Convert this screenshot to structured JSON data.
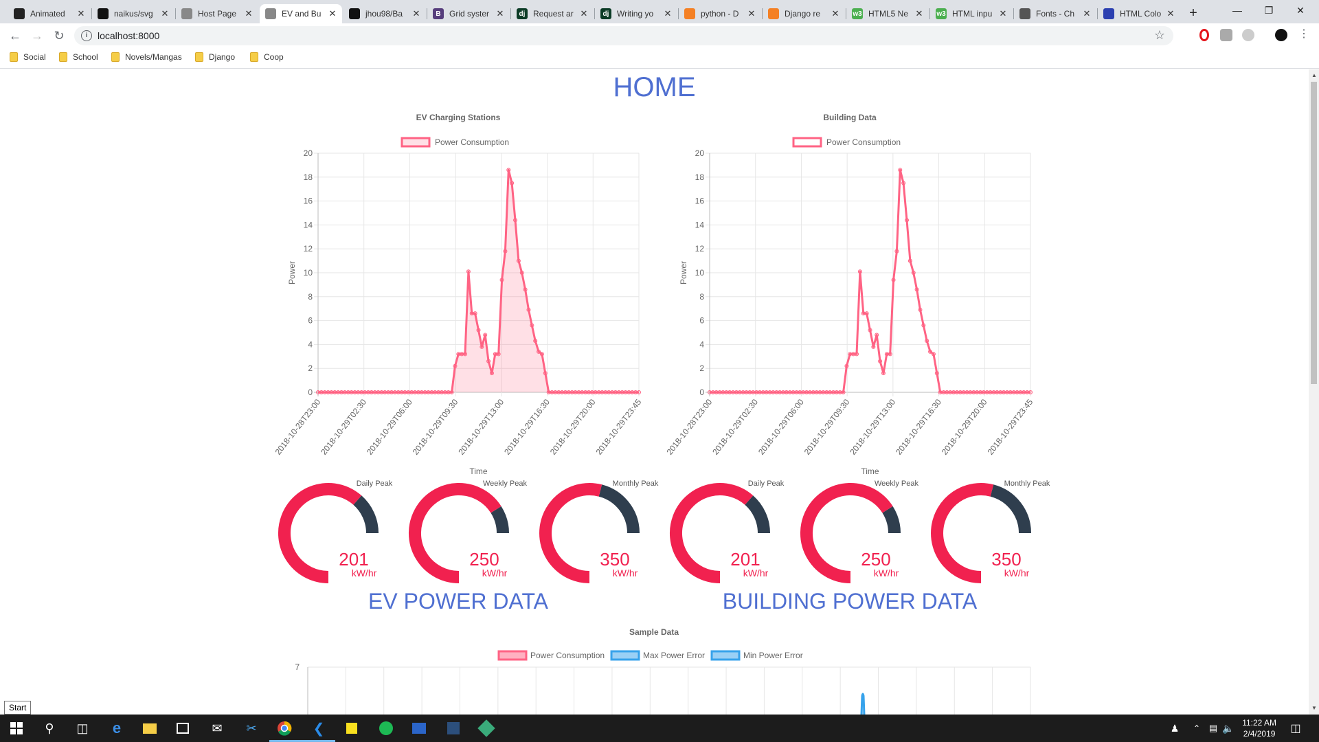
{
  "browser": {
    "tabs": [
      {
        "label": "Animated",
        "icon": "codepen-icon",
        "color": "#222"
      },
      {
        "label": "naikus/svg",
        "icon": "github-icon",
        "color": "#111"
      },
      {
        "label": "Host Page",
        "icon": "page-icon",
        "color": "#888"
      },
      {
        "label": "EV and Bu",
        "icon": "page-icon",
        "color": "#888",
        "active": true
      },
      {
        "label": "jhou98/Ba",
        "icon": "github-icon",
        "color": "#111"
      },
      {
        "label": "Grid syster",
        "icon": "bootstrap-icon",
        "color": "#563d7c",
        "glyph": "B"
      },
      {
        "label": "Request ar",
        "icon": "django-icon",
        "color": "#0c3c26",
        "glyph": "dj"
      },
      {
        "label": "Writing yo",
        "icon": "django-icon",
        "color": "#0c3c26",
        "glyph": "dj"
      },
      {
        "label": "python - D",
        "icon": "stackoverflow-icon",
        "color": "#f48024"
      },
      {
        "label": "Django re",
        "icon": "stackoverflow-icon",
        "color": "#f48024"
      },
      {
        "label": "HTML5 Ne",
        "icon": "w3schools-icon",
        "color": "#4caf50",
        "glyph": "w3"
      },
      {
        "label": "HTML inpu",
        "icon": "w3schools-icon",
        "color": "#4caf50",
        "glyph": "w3"
      },
      {
        "label": "Fonts - Ch",
        "icon": "book-icon",
        "color": "#555"
      },
      {
        "label": "HTML Colo",
        "icon": "html-colors-icon",
        "color": "#2b3fb0"
      }
    ],
    "url": "localhost:8000",
    "bookmarks": [
      "Social",
      "School",
      "Novels/Mangas",
      "Django",
      "Coop"
    ]
  },
  "page": {
    "title": "HOME",
    "ev_section_title": "EV POWER DATA",
    "building_section_title": "BUILDING POWER DATA"
  },
  "chart_data": [
    {
      "type": "area",
      "title": "EV Charging Stations",
      "xlabel": "Time",
      "ylabel": "Power",
      "ylim": [
        0,
        20
      ],
      "yticks": [
        0,
        2,
        4,
        6,
        8,
        10,
        12,
        14,
        16,
        18,
        20
      ],
      "xticks": [
        "2018-10-28T23:00",
        "2018-10-29T02:30",
        "2018-10-29T06:00",
        "2018-10-29T09:30",
        "2018-10-29T13:00",
        "2018-10-29T16:30",
        "2018-10-29T20:00",
        "2018-10-29T23:45"
      ],
      "legend": "top",
      "grid": true,
      "series": [
        {
          "name": "Power Consumption",
          "color": "#ff6384",
          "fill": "rgba(255,99,132,0.2)",
          "values": [
            0,
            0,
            0,
            0,
            0,
            0,
            0,
            0,
            0,
            0,
            0,
            0,
            0,
            0,
            0,
            0,
            0,
            0,
            0,
            0,
            0,
            0,
            0,
            0,
            0,
            0,
            0,
            0,
            0,
            0,
            0,
            0,
            0,
            0,
            0,
            0,
            0,
            0,
            0,
            0,
            0,
            2.2,
            3.2,
            3.2,
            3.2,
            10.1,
            6.6,
            6.6,
            5.2,
            3.8,
            4.8,
            2.6,
            1.6,
            3.2,
            3.2,
            9.4,
            11.8,
            18.6,
            17.5,
            14.4,
            11,
            10,
            8.6,
            6.9,
            5.6,
            4.3,
            3.4,
            3.2,
            1.6,
            0,
            0,
            0,
            0,
            0,
            0,
            0,
            0,
            0,
            0,
            0,
            0,
            0,
            0,
            0,
            0,
            0,
            0,
            0,
            0,
            0,
            0,
            0,
            0,
            0,
            0,
            0,
            0
          ]
        }
      ]
    },
    {
      "type": "line",
      "title": "Building Data",
      "xlabel": "Time",
      "ylabel": "Power",
      "ylim": [
        0,
        20
      ],
      "yticks": [
        0,
        2,
        4,
        6,
        8,
        10,
        12,
        14,
        16,
        18,
        20
      ],
      "xticks": [
        "2018-10-28T23:00",
        "2018-10-29T02:30",
        "2018-10-29T06:00",
        "2018-10-29T09:30",
        "2018-10-29T13:00",
        "2018-10-29T16:30",
        "2018-10-29T20:00",
        "2018-10-29T23:45"
      ],
      "legend": "top",
      "grid": true,
      "series": [
        {
          "name": "Power Consumption",
          "color": "#ff6384",
          "values": [
            0,
            0,
            0,
            0,
            0,
            0,
            0,
            0,
            0,
            0,
            0,
            0,
            0,
            0,
            0,
            0,
            0,
            0,
            0,
            0,
            0,
            0,
            0,
            0,
            0,
            0,
            0,
            0,
            0,
            0,
            0,
            0,
            0,
            0,
            0,
            0,
            0,
            0,
            0,
            0,
            0,
            2.2,
            3.2,
            3.2,
            3.2,
            10.1,
            6.6,
            6.6,
            5.2,
            3.8,
            4.8,
            2.6,
            1.6,
            3.2,
            3.2,
            9.4,
            11.8,
            18.6,
            17.5,
            14.4,
            11,
            10,
            8.6,
            6.9,
            5.6,
            4.3,
            3.4,
            3.2,
            1.6,
            0,
            0,
            0,
            0,
            0,
            0,
            0,
            0,
            0,
            0,
            0,
            0,
            0,
            0,
            0,
            0,
            0,
            0,
            0,
            0,
            0,
            0,
            0,
            0,
            0,
            0,
            0,
            0
          ]
        }
      ]
    },
    {
      "type": "line",
      "title": "Sample Data",
      "legend": "top",
      "grid": true,
      "yticks_visible": [
        7
      ],
      "series": [
        {
          "name": "Power Consumption",
          "color": "#ff6384"
        },
        {
          "name": "Max Power Error",
          "color": "#36a2eb"
        },
        {
          "name": "Min Power Error",
          "color": "#36a2eb"
        }
      ]
    }
  ],
  "gauges": [
    {
      "label": "Daily Peak",
      "value": "201",
      "unit": "kW/hr",
      "fraction": 0.82
    },
    {
      "label": "Weekly Peak",
      "value": "250",
      "unit": "kW/hr",
      "fraction": 0.88
    },
    {
      "label": "Monthly Peak",
      "value": "350",
      "unit": "kW/hr",
      "fraction": 0.72
    },
    {
      "label": "Daily Peak",
      "value": "201",
      "unit": "kW/hr",
      "fraction": 0.82
    },
    {
      "label": "Weekly Peak",
      "value": "250",
      "unit": "kW/hr",
      "fraction": 0.88
    },
    {
      "label": "Monthly Peak",
      "value": "350",
      "unit": "kW/hr",
      "fraction": 0.72
    }
  ],
  "colors": {
    "gauge_fill": "#f1214f",
    "gauge_bg": "#2f3e4e",
    "heading": "#4f6fd1"
  },
  "taskbar": {
    "start_tooltip": "Start",
    "time": "11:22 AM",
    "date": "2/4/2019"
  }
}
